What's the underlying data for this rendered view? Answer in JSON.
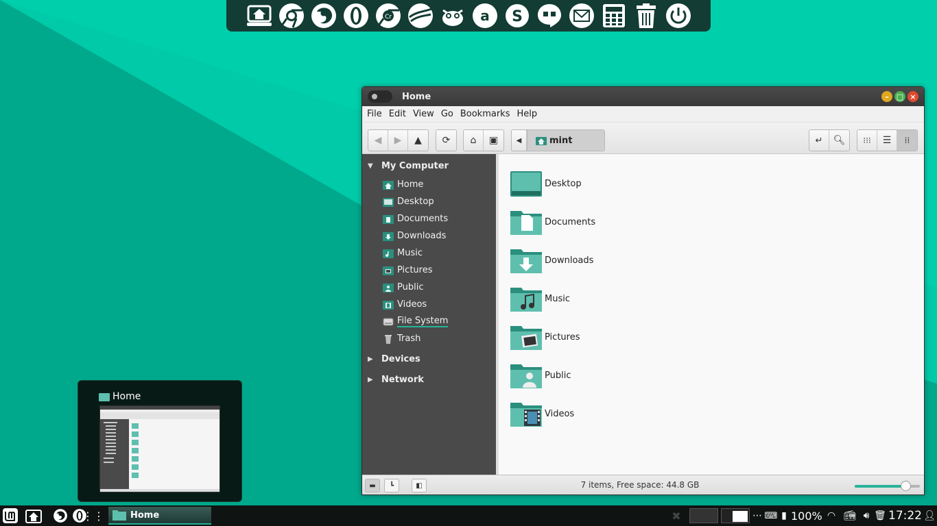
{
  "window": {
    "title": "Home"
  },
  "menubar": [
    "File",
    "Edit",
    "View",
    "Go",
    "Bookmarks",
    "Help"
  ],
  "location": {
    "path_label": "mint"
  },
  "sidebar": {
    "my_computer_header": "My Computer",
    "items": [
      {
        "label": "Home",
        "icon": "home-folder-icon"
      },
      {
        "label": "Desktop",
        "icon": "desktop-folder-icon"
      },
      {
        "label": "Documents",
        "icon": "documents-folder-icon"
      },
      {
        "label": "Downloads",
        "icon": "downloads-folder-icon"
      },
      {
        "label": "Music",
        "icon": "music-folder-icon"
      },
      {
        "label": "Pictures",
        "icon": "pictures-folder-icon"
      },
      {
        "label": "Public",
        "icon": "public-folder-icon"
      },
      {
        "label": "Videos",
        "icon": "videos-folder-icon"
      },
      {
        "label": "File System",
        "icon": "drive-icon"
      },
      {
        "label": "Trash",
        "icon": "trash-icon"
      }
    ],
    "devices_header": "Devices",
    "network_header": "Network"
  },
  "files": [
    {
      "name": "Desktop",
      "icon": "desktop-folder-icon"
    },
    {
      "name": "Documents",
      "icon": "documents-folder-icon"
    },
    {
      "name": "Downloads",
      "icon": "downloads-folder-icon"
    },
    {
      "name": "Music",
      "icon": "music-folder-icon"
    },
    {
      "name": "Pictures",
      "icon": "pictures-folder-icon"
    },
    {
      "name": "Public",
      "icon": "public-folder-icon"
    },
    {
      "name": "Videos",
      "icon": "videos-folder-icon"
    }
  ],
  "status": {
    "text": "7 items, Free space: 44.8 GB",
    "zoom_level": 0.78
  },
  "preview": {
    "title": "Home"
  },
  "taskbar": {
    "task_label": "Home",
    "battery": "100%",
    "clock": "17:22"
  },
  "dock_icons": [
    "home-icon",
    "chrome-icon",
    "firefox-icon",
    "opera-icon",
    "chromium-icon",
    "google-earth-icon",
    "gimp-icon",
    "amazon-icon",
    "skype-icon",
    "hangouts-icon",
    "mail-icon",
    "calculator-icon",
    "trash-icon",
    "power-icon"
  ],
  "colors": {
    "accent": "#26b39a",
    "desktop_light": "#00caa8",
    "desktop_dark": "#00a88c",
    "sidebar_bg": "#4a4a4a"
  }
}
